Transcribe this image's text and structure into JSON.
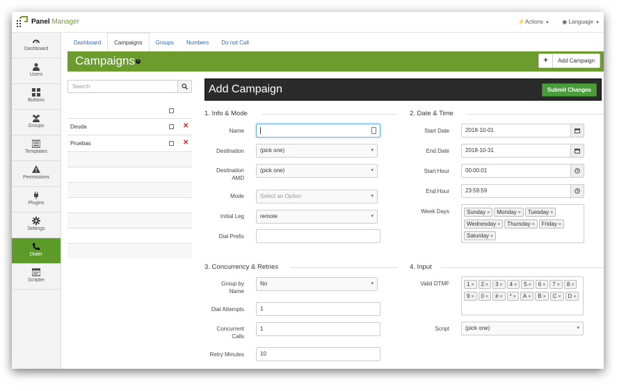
{
  "app": {
    "brand_bold": "Panel",
    "brand_light": "Manager"
  },
  "topbar": {
    "actions": "Actions",
    "language": "Language"
  },
  "sidebar": {
    "items": [
      {
        "label": "Dashboard",
        "icon": "dashboard-icon"
      },
      {
        "label": "Users",
        "icon": "user-icon"
      },
      {
        "label": "Buttons",
        "icon": "grid-icon"
      },
      {
        "label": "Groups",
        "icon": "group-icon"
      },
      {
        "label": "Templates",
        "icon": "template-icon"
      },
      {
        "label": "Permissions",
        "icon": "warning-icon"
      },
      {
        "label": "Plugins",
        "icon": "plug-icon"
      },
      {
        "label": "Settings",
        "icon": "gear-icon"
      },
      {
        "label": "Dialer",
        "icon": "phone-icon",
        "active": true
      },
      {
        "label": "Scripter",
        "icon": "scripter-icon"
      }
    ]
  },
  "tabs": [
    "Dashboard",
    "Campaigns",
    "Groups",
    "Numbers",
    "Do not Call"
  ],
  "active_tab": "Campaigns",
  "header": {
    "title": "Campaigns",
    "add_button": "Add Campaign"
  },
  "search": {
    "placeholder": "Search"
  },
  "campaigns": [
    {
      "name": "Deuda"
    },
    {
      "name": "Pruebas"
    }
  ],
  "form": {
    "title": "Add Campaign",
    "submit": "Submit Changes",
    "sections": {
      "info": "1. Info & Mode",
      "datetime": "2. Date & Time",
      "concurrency": "3. Concurrency & Retries",
      "input": "4. Input"
    },
    "info": {
      "name_label": "Name",
      "name_value": "",
      "destination_label": "Destination",
      "destination_value": "(pick one)",
      "destination_amd_label_1": "Destination",
      "destination_amd_label_2": "AMD",
      "destination_amd_value": "(pick one)",
      "mode_label": "Mode",
      "mode_placeholder": "Select an Option",
      "initial_leg_label": "Initial Leg",
      "initial_leg_value": "remote",
      "dial_prefix_label": "Dial Prefix",
      "dial_prefix_value": ""
    },
    "datetime": {
      "start_date_label": "Start Date",
      "start_date_value": "2018-10-01",
      "end_date_label": "End Date",
      "end_date_value": "2018-10-31",
      "start_hour_label": "Start Hour",
      "start_hour_value": "00:00:01",
      "end_hour_label": "End Hour",
      "end_hour_value": "23:59:59",
      "week_days_label": "Week Days",
      "week_days": [
        "Sunday",
        "Monday",
        "Tuesday",
        "Wednesday",
        "Thursday",
        "Friday",
        "Saturday"
      ]
    },
    "concurrency": {
      "group_by_name_label_1": "Group by",
      "group_by_name_label_2": "Name",
      "group_by_name_value": "No",
      "dial_attempts_label": "Dial Attempts",
      "dial_attempts_value": "1",
      "concurrent_calls_label_1": "Concurrent",
      "concurrent_calls_label_2": "Calls",
      "concurrent_calls_value": "1",
      "retry_minutes_label": "Retry Minutes",
      "retry_minutes_value": "10"
    },
    "input": {
      "valid_dtmf_label": "Valid DTMF",
      "valid_dtmf": [
        "1",
        "2",
        "3",
        "4",
        "5",
        "6",
        "7",
        "8",
        "9",
        "0",
        "#",
        "*",
        "A",
        "B",
        "C",
        "D"
      ],
      "script_label": "Script",
      "script_value": "(pick one)"
    }
  },
  "colors": {
    "brand_green": "#6c9c2e",
    "dialer_active": "#5c9a2a",
    "submit_green": "#4a9d3a",
    "link_blue": "#2a6ab3",
    "delete_red": "#dd2222"
  }
}
